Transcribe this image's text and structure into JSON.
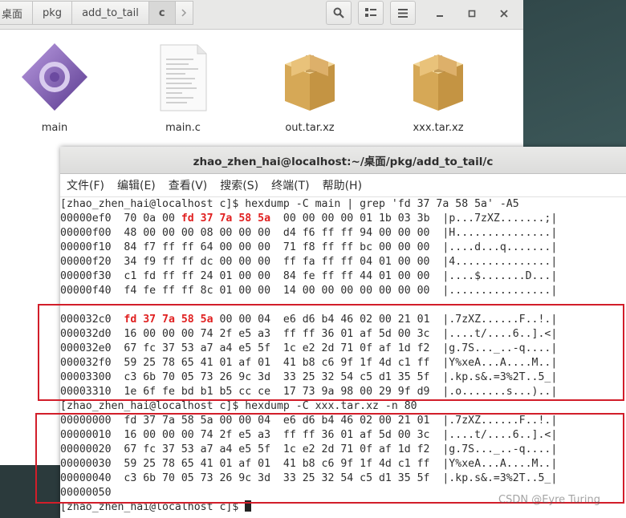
{
  "file_manager": {
    "breadcrumbs": [
      "桌面",
      "pkg",
      "add_to_tail",
      "c"
    ],
    "files": [
      {
        "name": "main",
        "icon": "executable-icon"
      },
      {
        "name": "main.c",
        "icon": "text-document-icon"
      },
      {
        "name": "out.tar.xz",
        "icon": "package-icon"
      },
      {
        "name": "xxx.tar.xz",
        "icon": "package-icon"
      }
    ]
  },
  "terminal": {
    "title": "zhao_zhen_hai@localhost:~/桌面/pkg/add_to_tail/c",
    "menu": [
      "文件(F)",
      "编辑(E)",
      "查看(V)",
      "搜索(S)",
      "终端(T)",
      "帮助(H)"
    ],
    "lines": [
      [
        {
          "t": "[zhao_zhen_hai@localhost c]$ hexdump -C main | grep 'fd 37 7a 58 5a' -A5"
        }
      ],
      [
        {
          "t": "00000ef0  70 0a 00 "
        },
        {
          "t": "fd 37 7a 58 5a",
          "h": 1
        },
        {
          "t": "  00 00 00 00 01 1b 03 3b  |p...7zXZ.......;|"
        }
      ],
      [
        {
          "t": "00000f00  48 00 00 00 08 00 00 00  d4 f6 ff ff 94 00 00 00  |H...............|"
        }
      ],
      [
        {
          "t": "00000f10  84 f7 ff ff 64 00 00 00  71 f8 ff ff bc 00 00 00  |....d...q.......|"
        }
      ],
      [
        {
          "t": "00000f20  34 f9 ff ff dc 00 00 00  ff fa ff ff 04 01 00 00  |4...............|"
        }
      ],
      [
        {
          "t": "00000f30  c1 fd ff ff 24 01 00 00  84 fe ff ff 44 01 00 00  |....$.......D...|"
        }
      ],
      [
        {
          "t": "00000f40  f4 fe ff ff 8c 01 00 00  14 00 00 00 00 00 00 00  |................|"
        }
      ],
      [
        {
          "t": "--",
          "s": 1
        }
      ],
      [
        {
          "t": "000032c0  "
        },
        {
          "t": "fd 37 7a 58 5a",
          "h": 1
        },
        {
          "t": " 00 00 04  e6 d6 b4 46 02 00 21 01  |.7zXZ......F..!.|"
        }
      ],
      [
        {
          "t": "000032d0  16 00 00 00 74 2f e5 a3  ff ff 36 01 af 5d 00 3c  |....t/....6..].<|"
        }
      ],
      [
        {
          "t": "000032e0  67 fc 37 53 a7 a4 e5 5f  1c e2 2d 71 0f af 1d f2  |g.7S..._..-q....|"
        }
      ],
      [
        {
          "t": "000032f0  59 25 78 65 41 01 af 01  41 b8 c6 9f 1f 4d c1 ff  |Y%xeA...A....M..|"
        }
      ],
      [
        {
          "t": "00003300  c3 6b 70 05 73 26 9c 3d  33 25 32 54 c5 d1 35 5f  |.kp.s&.=3%2T..5_|"
        }
      ],
      [
        {
          "t": "00003310  1e 6f fe bd b1 b5 cc ce  17 73 9a 98 00 29 9f d9  |.o.......s...)..|"
        }
      ],
      [
        {
          "t": "[zhao_zhen_hai@localhost c]$ hexdump -C xxx.tar.xz -n 80"
        }
      ],
      [
        {
          "t": "00000000  fd 37 7a 58 5a 00 00 04  e6 d6 b4 46 02 00 21 01  |.7zXZ......F..!.|"
        }
      ],
      [
        {
          "t": "00000010  16 00 00 00 74 2f e5 a3  ff ff 36 01 af 5d 00 3c  |....t/....6..].<|"
        }
      ],
      [
        {
          "t": "00000020  67 fc 37 53 a7 a4 e5 5f  1c e2 2d 71 0f af 1d f2  |g.7S..._..-q....|"
        }
      ],
      [
        {
          "t": "00000030  59 25 78 65 41 01 af 01  41 b8 c6 9f 1f 4d c1 ff  |Y%xeA...A....M..|"
        }
      ],
      [
        {
          "t": "00000040  c3 6b 70 05 73 26 9c 3d  33 25 32 54 c5 d1 35 5f  |.kp.s&.=3%2T..5_|"
        }
      ],
      [
        {
          "t": "00000050"
        }
      ],
      [
        {
          "t": "[zhao_zhen_hai@localhost c]$ "
        }
      ]
    ]
  },
  "watermark": "CSDN @Eyre Turing",
  "colors": {
    "highlight": "#e02020",
    "annotation_box": "#d21e2a"
  }
}
